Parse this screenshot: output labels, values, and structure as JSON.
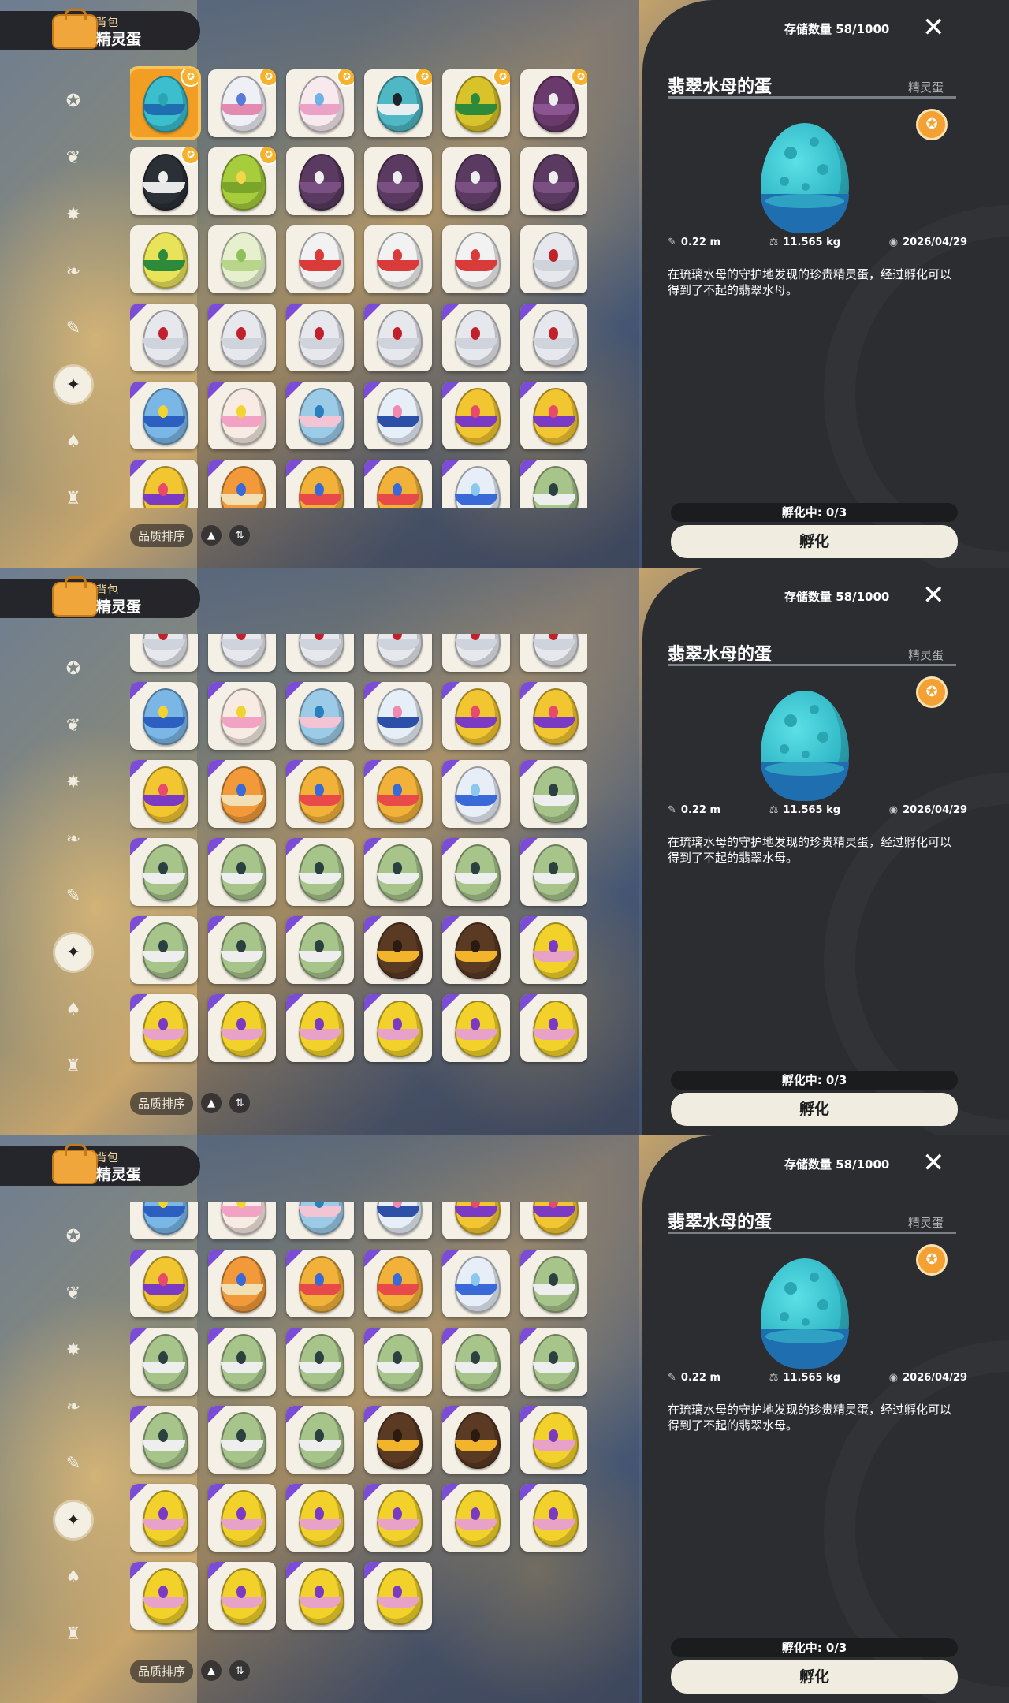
{
  "header": {
    "subtitle": "背包",
    "title": "精灵蛋"
  },
  "tabs": [
    {
      "icon": "star-badge-icon"
    },
    {
      "icon": "leaf-icon"
    },
    {
      "icon": "sparkle-icon"
    },
    {
      "icon": "plant-icon"
    },
    {
      "icon": "scroll-icon"
    },
    {
      "icon": "egg-tab-icon",
      "active": true
    },
    {
      "icon": "acorn-icon"
    },
    {
      "icon": "furniture-icon"
    }
  ],
  "sort": {
    "label": "品质排序"
  },
  "detail": {
    "storage": "存储数量 58/1000",
    "close": "✕",
    "name": "翡翠水母的蛋",
    "category": "精灵蛋",
    "stat_size": "0.22 m",
    "stat_weight": "11.565 kg",
    "stat_date": "2026/04/29",
    "description": "在琉璃水母的守护地发现的珍贵精灵蛋，经过孵化可以得到了不起的翡翠水母。",
    "hatching": "孵化中: 0/3",
    "hatch_button": "孵化"
  },
  "colors": {
    "accent": "#f29d23",
    "purple": "#7b4dd6",
    "panel": "#2b2d30",
    "cream": "#f5f0e6"
  },
  "eggs": [
    {
      "c": "#3bbfcf",
      "b": "#1f6fb0",
      "s": "#2aa6b3",
      "m": 1,
      "sel": 1
    },
    {
      "c": "#eef0f6",
      "b": "#e48ab0",
      "s": "#5a7ad8",
      "m": 1
    },
    {
      "c": "#f7e9ee",
      "b": "#eaa3c6",
      "s": "#6fb2e8",
      "m": 1
    },
    {
      "c": "#4fb8c4",
      "b": "#e8eef0",
      "s": "#1d2328",
      "m": 1
    },
    {
      "c": "#d9c32a",
      "b": "#2c8a3a",
      "s": "#2c8a3a",
      "m": 1
    },
    {
      "c": "#6a3a6c",
      "b": "#8a5590",
      "s": "#eeeeee",
      "m": 1
    },
    {
      "c": "#2b2f36",
      "b": "#e8e8e8",
      "s": "#eeeeee",
      "m": 1
    },
    {
      "c": "#a7cc3c",
      "b": "#7aa52a",
      "s": "#f4d64a",
      "m": 1
    },
    {
      "c": "#5a3a60",
      "b": "#7a4f82",
      "s": "#eeeeee"
    },
    {
      "c": "#5a3a60",
      "b": "#7a4f82",
      "s": "#eeeeee"
    },
    {
      "c": "#5a3a60",
      "b": "#7a4f82",
      "s": "#eeeeee"
    },
    {
      "c": "#5a3a60",
      "b": "#7a4f82",
      "s": "#eeeeee"
    },
    {
      "c": "#e9e35a",
      "b": "#2c8a3a",
      "s": "#2c8a3a"
    },
    {
      "c": "#e6f0cf",
      "b": "#b7d68a",
      "s": "#8fbf5a"
    },
    {
      "c": "#f2f2f2",
      "b": "#d93b3b",
      "s": "#d93b3b"
    },
    {
      "c": "#f2f2f2",
      "b": "#d93b3b",
      "s": "#d93b3b"
    },
    {
      "c": "#f2f2f2",
      "b": "#d93b3b",
      "s": "#d93b3b"
    },
    {
      "c": "#e6e8ee",
      "b": "#cfd3dc",
      "s": "#c2202a"
    },
    {
      "c": "#e6e8ee",
      "b": "#cfd3dc",
      "s": "#c2202a",
      "t": 1
    },
    {
      "c": "#e6e8ee",
      "b": "#cfd3dc",
      "s": "#c2202a",
      "t": 1
    },
    {
      "c": "#e6e8ee",
      "b": "#cfd3dc",
      "s": "#c2202a",
      "t": 1
    },
    {
      "c": "#e6e8ee",
      "b": "#cfd3dc",
      "s": "#c2202a",
      "t": 1
    },
    {
      "c": "#e6e8ee",
      "b": "#cfd3dc",
      "s": "#c2202a",
      "t": 1
    },
    {
      "c": "#e6e8ee",
      "b": "#cfd3dc",
      "s": "#c2202a",
      "t": 1
    },
    {
      "c": "#7ab6e6",
      "b": "#2c5fbf",
      "s": "#f2d430",
      "t": 1
    },
    {
      "c": "#f7ebe3",
      "b": "#f2a2c2",
      "s": "#f2d430",
      "t": 1
    },
    {
      "c": "#9ccbe8",
      "b": "#f2c4d4",
      "s": "#2c7fbf",
      "t": 1
    },
    {
      "c": "#e6eef8",
      "b": "#2c4fa8",
      "s": "#f28ab0",
      "t": 1
    },
    {
      "c": "#f2c631",
      "b": "#7a3ac4",
      "s": "#e84a6a",
      "t": 1
    },
    {
      "c": "#f2c631",
      "b": "#7a3ac4",
      "s": "#e84a6a",
      "t": 1
    },
    {
      "c": "#f2c631",
      "b": "#7a3ac4",
      "s": "#e84a6a",
      "t": 1
    },
    {
      "c": "#f29a3a",
      "b": "#f2e0b4",
      "s": "#3a6ad8",
      "t": 1
    },
    {
      "c": "#f2b23a",
      "b": "#e84a4a",
      "s": "#3a6ad8",
      "t": 1
    },
    {
      "c": "#f2b23a",
      "b": "#e84a4a",
      "s": "#3a6ad8",
      "t": 1
    },
    {
      "c": "#e8eef8",
      "b": "#3a6ad8",
      "s": "#8ac8f0",
      "t": 1
    },
    {
      "c": "#a7c48a",
      "b": "#eeeeee",
      "s": "#2b4040",
      "t": 1
    }
  ],
  "eggs_p2": [
    {
      "c": "#e6e8ee",
      "b": "#cfd3dc",
      "s": "#c2202a",
      "t": 1
    },
    {
      "c": "#e6e8ee",
      "b": "#cfd3dc",
      "s": "#c2202a",
      "t": 1
    },
    {
      "c": "#e6e8ee",
      "b": "#cfd3dc",
      "s": "#c2202a",
      "t": 1
    },
    {
      "c": "#e6e8ee",
      "b": "#cfd3dc",
      "s": "#c2202a",
      "t": 1
    },
    {
      "c": "#e6e8ee",
      "b": "#cfd3dc",
      "s": "#c2202a",
      "t": 1
    },
    {
      "c": "#e6e8ee",
      "b": "#cfd3dc",
      "s": "#c2202a",
      "t": 1
    },
    {
      "c": "#7ab6e6",
      "b": "#2c5fbf",
      "s": "#f2d430",
      "t": 1
    },
    {
      "c": "#f7ebe3",
      "b": "#f2a2c2",
      "s": "#f2d430",
      "t": 1
    },
    {
      "c": "#9ccbe8",
      "b": "#f2c4d4",
      "s": "#2c7fbf",
      "t": 1
    },
    {
      "c": "#e6eef8",
      "b": "#2c4fa8",
      "s": "#f28ab0",
      "t": 1
    },
    {
      "c": "#f2c631",
      "b": "#7a3ac4",
      "s": "#e84a6a",
      "t": 1
    },
    {
      "c": "#f2c631",
      "b": "#7a3ac4",
      "s": "#e84a6a",
      "t": 1
    },
    {
      "c": "#f2c631",
      "b": "#7a3ac4",
      "s": "#e84a6a",
      "t": 1
    },
    {
      "c": "#f29a3a",
      "b": "#f2e0b4",
      "s": "#3a6ad8",
      "t": 1
    },
    {
      "c": "#f2b23a",
      "b": "#e84a4a",
      "s": "#3a6ad8",
      "t": 1
    },
    {
      "c": "#f2b23a",
      "b": "#e84a4a",
      "s": "#3a6ad8",
      "t": 1
    },
    {
      "c": "#e8eef8",
      "b": "#3a6ad8",
      "s": "#8ac8f0",
      "t": 1
    },
    {
      "c": "#a7c48a",
      "b": "#eeeeee",
      "s": "#2b4040",
      "t": 1
    },
    {
      "c": "#a7c48a",
      "b": "#eeeeee",
      "s": "#2b4040",
      "t": 1
    },
    {
      "c": "#a7c48a",
      "b": "#eeeeee",
      "s": "#2b4040",
      "t": 1
    },
    {
      "c": "#a7c48a",
      "b": "#eeeeee",
      "s": "#2b4040",
      "t": 1
    },
    {
      "c": "#a7c48a",
      "b": "#eeeeee",
      "s": "#2b4040",
      "t": 1
    },
    {
      "c": "#a7c48a",
      "b": "#eeeeee",
      "s": "#2b4040",
      "t": 1
    },
    {
      "c": "#a7c48a",
      "b": "#eeeeee",
      "s": "#2b4040",
      "t": 1
    },
    {
      "c": "#a7c48a",
      "b": "#eeeeee",
      "s": "#2b4040",
      "t": 1
    },
    {
      "c": "#a7c48a",
      "b": "#eeeeee",
      "s": "#2b4040",
      "t": 1
    },
    {
      "c": "#a7c48a",
      "b": "#eeeeee",
      "s": "#2b4040",
      "t": 1
    },
    {
      "c": "#5a3a22",
      "b": "#f2b42a",
      "s": "#2b1a10",
      "t": 1
    },
    {
      "c": "#5a3a22",
      "b": "#f2b42a",
      "s": "#2b1a10",
      "t": 1
    },
    {
      "c": "#f2d22a",
      "b": "#e8a2c8",
      "s": "#7a3ac4",
      "t": 1
    },
    {
      "c": "#f2d22a",
      "b": "#e8a2c8",
      "s": "#7a3ac4",
      "t": 1
    },
    {
      "c": "#f2d22a",
      "b": "#e8a2c8",
      "s": "#7a3ac4",
      "t": 1
    },
    {
      "c": "#f2d22a",
      "b": "#e8a2c8",
      "s": "#7a3ac4",
      "t": 1
    },
    {
      "c": "#f2d22a",
      "b": "#e8a2c8",
      "s": "#7a3ac4",
      "t": 1
    },
    {
      "c": "#f2d22a",
      "b": "#e8a2c8",
      "s": "#7a3ac4",
      "t": 1
    },
    {
      "c": "#f2d22a",
      "b": "#e8a2c8",
      "s": "#7a3ac4",
      "t": 1
    }
  ],
  "eggs_p3": [
    {
      "c": "#7ab6e6",
      "b": "#2c5fbf",
      "s": "#f2d430",
      "t": 1
    },
    {
      "c": "#f7ebe3",
      "b": "#f2a2c2",
      "s": "#f2d430",
      "t": 1
    },
    {
      "c": "#9ccbe8",
      "b": "#f2c4d4",
      "s": "#2c7fbf",
      "t": 1
    },
    {
      "c": "#e6eef8",
      "b": "#2c4fa8",
      "s": "#f28ab0",
      "t": 1
    },
    {
      "c": "#f2c631",
      "b": "#7a3ac4",
      "s": "#e84a6a",
      "t": 1
    },
    {
      "c": "#f2c631",
      "b": "#7a3ac4",
      "s": "#e84a6a",
      "t": 1
    },
    {
      "c": "#f2c631",
      "b": "#7a3ac4",
      "s": "#e84a6a",
      "t": 1
    },
    {
      "c": "#f29a3a",
      "b": "#f2e0b4",
      "s": "#3a6ad8",
      "t": 1
    },
    {
      "c": "#f2b23a",
      "b": "#e84a4a",
      "s": "#3a6ad8",
      "t": 1
    },
    {
      "c": "#f2b23a",
      "b": "#e84a4a",
      "s": "#3a6ad8",
      "t": 1
    },
    {
      "c": "#e8eef8",
      "b": "#3a6ad8",
      "s": "#8ac8f0",
      "t": 1
    },
    {
      "c": "#a7c48a",
      "b": "#eeeeee",
      "s": "#2b4040",
      "t": 1
    },
    {
      "c": "#a7c48a",
      "b": "#eeeeee",
      "s": "#2b4040",
      "t": 1
    },
    {
      "c": "#a7c48a",
      "b": "#eeeeee",
      "s": "#2b4040",
      "t": 1
    },
    {
      "c": "#a7c48a",
      "b": "#eeeeee",
      "s": "#2b4040",
      "t": 1
    },
    {
      "c": "#a7c48a",
      "b": "#eeeeee",
      "s": "#2b4040",
      "t": 1
    },
    {
      "c": "#a7c48a",
      "b": "#eeeeee",
      "s": "#2b4040",
      "t": 1
    },
    {
      "c": "#a7c48a",
      "b": "#eeeeee",
      "s": "#2b4040",
      "t": 1
    },
    {
      "c": "#a7c48a",
      "b": "#eeeeee",
      "s": "#2b4040",
      "t": 1
    },
    {
      "c": "#a7c48a",
      "b": "#eeeeee",
      "s": "#2b4040",
      "t": 1
    },
    {
      "c": "#a7c48a",
      "b": "#eeeeee",
      "s": "#2b4040",
      "t": 1
    },
    {
      "c": "#5a3a22",
      "b": "#f2b42a",
      "s": "#2b1a10",
      "t": 1
    },
    {
      "c": "#5a3a22",
      "b": "#f2b42a",
      "s": "#2b1a10",
      "t": 1
    },
    {
      "c": "#f2d22a",
      "b": "#e8a2c8",
      "s": "#7a3ac4",
      "t": 1
    },
    {
      "c": "#f2d22a",
      "b": "#e8a2c8",
      "s": "#7a3ac4",
      "t": 1
    },
    {
      "c": "#f2d22a",
      "b": "#e8a2c8",
      "s": "#7a3ac4",
      "t": 1
    },
    {
      "c": "#f2d22a",
      "b": "#e8a2c8",
      "s": "#7a3ac4",
      "t": 1
    },
    {
      "c": "#f2d22a",
      "b": "#e8a2c8",
      "s": "#7a3ac4",
      "t": 1
    },
    {
      "c": "#f2d22a",
      "b": "#e8a2c8",
      "s": "#7a3ac4",
      "t": 1
    },
    {
      "c": "#f2d22a",
      "b": "#e8a2c8",
      "s": "#7a3ac4",
      "t": 1
    },
    {
      "c": "#f2d22a",
      "b": "#e8a2c8",
      "s": "#7a3ac4",
      "t": 1
    },
    {
      "c": "#f2d22a",
      "b": "#e8a2c8",
      "s": "#7a3ac4",
      "t": 1
    },
    {
      "c": "#f2d22a",
      "b": "#e8a2c8",
      "s": "#7a3ac4",
      "t": 1
    },
    {
      "c": "#f2d22a",
      "b": "#e8a2c8",
      "s": "#7a3ac4",
      "t": 1
    }
  ]
}
